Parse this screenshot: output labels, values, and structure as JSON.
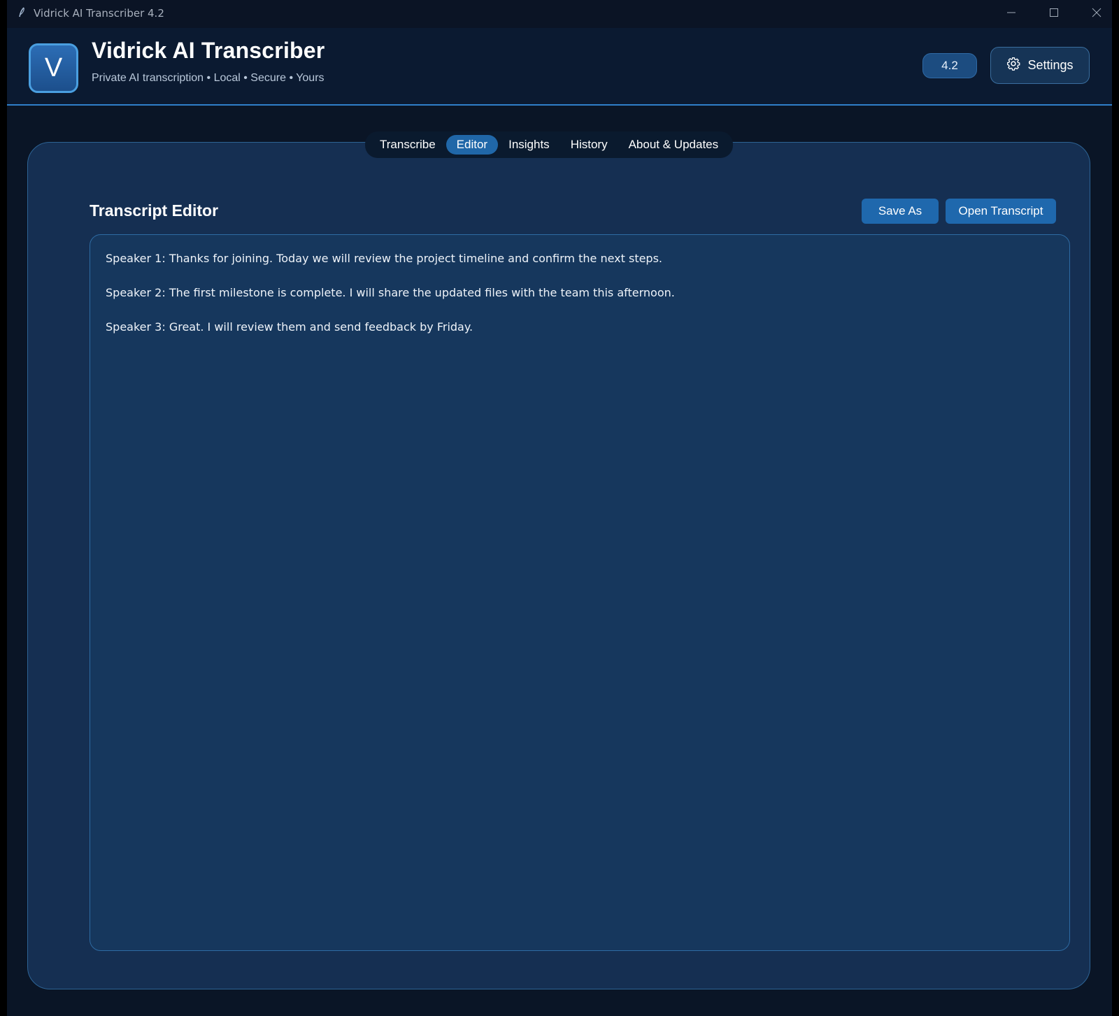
{
  "window": {
    "title": "Vidrick AI Transcriber 4.2"
  },
  "header": {
    "logo_letter": "V",
    "title": "Vidrick AI Transcriber",
    "subtitle": "Private AI transcription • Local • Secure • Yours",
    "version": "4.2",
    "settings_label": "Settings"
  },
  "tabs": [
    {
      "label": "Transcribe",
      "active": false
    },
    {
      "label": "Editor",
      "active": true
    },
    {
      "label": "Insights",
      "active": false
    },
    {
      "label": "History",
      "active": false
    },
    {
      "label": "About & Updates",
      "active": false
    }
  ],
  "editor": {
    "title": "Transcript Editor",
    "save_as_label": "Save As",
    "open_label": "Open Transcript",
    "lines": [
      "Speaker 1: Thanks for joining. Today we will review the project timeline and confirm the next steps.",
      "Speaker 2: The first milestone is complete. I will share the updated files with the team this afternoon.",
      "Speaker 3: Great. I will review them and send feedback by Friday."
    ]
  },
  "colors": {
    "accent": "#2067a8",
    "header_border": "#2f7fc9",
    "panel_bg": "#152f52",
    "window_bg": "#0a1526"
  },
  "icons": {
    "app": "feather-icon",
    "settings": "gear-icon",
    "minimize": "minimize-icon",
    "maximize": "maximize-icon",
    "close": "close-icon"
  }
}
